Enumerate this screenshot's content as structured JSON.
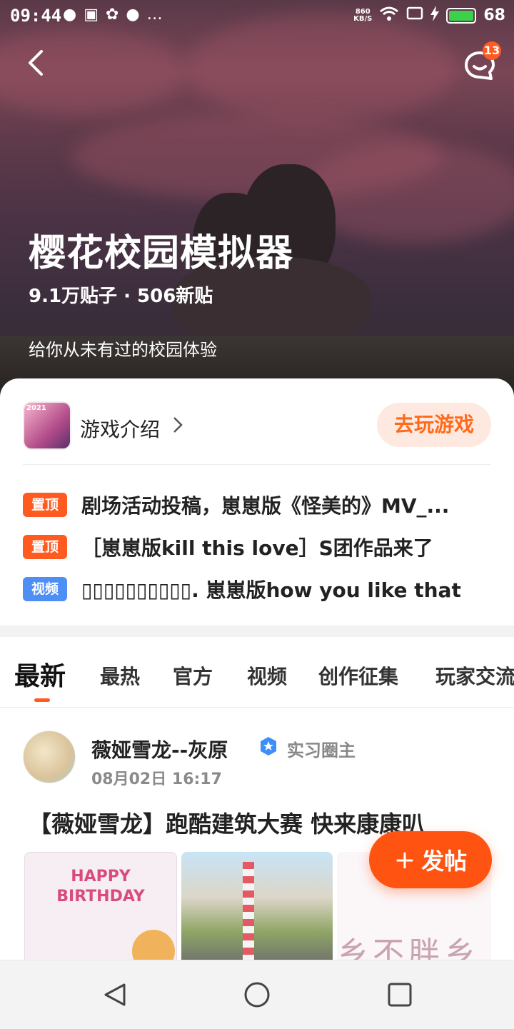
{
  "status_bar": {
    "time": "09:44",
    "net_speed_top": "860",
    "net_speed_bottom": "KB/S",
    "battery": "68"
  },
  "header": {
    "message_badge": "13",
    "game_title": "樱花校园模拟器",
    "stats": "9.1万贴子 · 506新贴",
    "description": "给你从未有过的校园体验"
  },
  "card": {
    "icon_tag": "2021",
    "intro_label": "游戏介绍",
    "play_button": "去玩游戏",
    "pinned": [
      {
        "badge": "置顶",
        "type": "top",
        "text": "剧场活动投稿，崽崽版《怪美的》MV_..."
      },
      {
        "badge": "置顶",
        "type": "top",
        "text": "［崽崽版kill this love］S团作品来了"
      },
      {
        "badge": "视频",
        "type": "video",
        "text": "▯▯▯▯▯▯▯▯▯▯. 崽崽版how you like that"
      }
    ]
  },
  "tabs": [
    "最新",
    "最热",
    "官方",
    "视频",
    "创作征集",
    "玩家交流"
  ],
  "post": {
    "author": "薇娅雪龙--灰原",
    "role": "实习圈主",
    "time": "08月02日  16:17",
    "title": "【薇娅雪龙】跑酷建筑大赛  快来康康叭",
    "thumb1_text": "HAPPY BIRTHDAY",
    "thumb3_text": "乡不胖乡"
  },
  "fab": {
    "plus": "+",
    "label": "发帖"
  },
  "colors": {
    "accent": "#ff5a1f",
    "video_badge": "#4d8ff4",
    "play_bg": "#fde9df"
  }
}
